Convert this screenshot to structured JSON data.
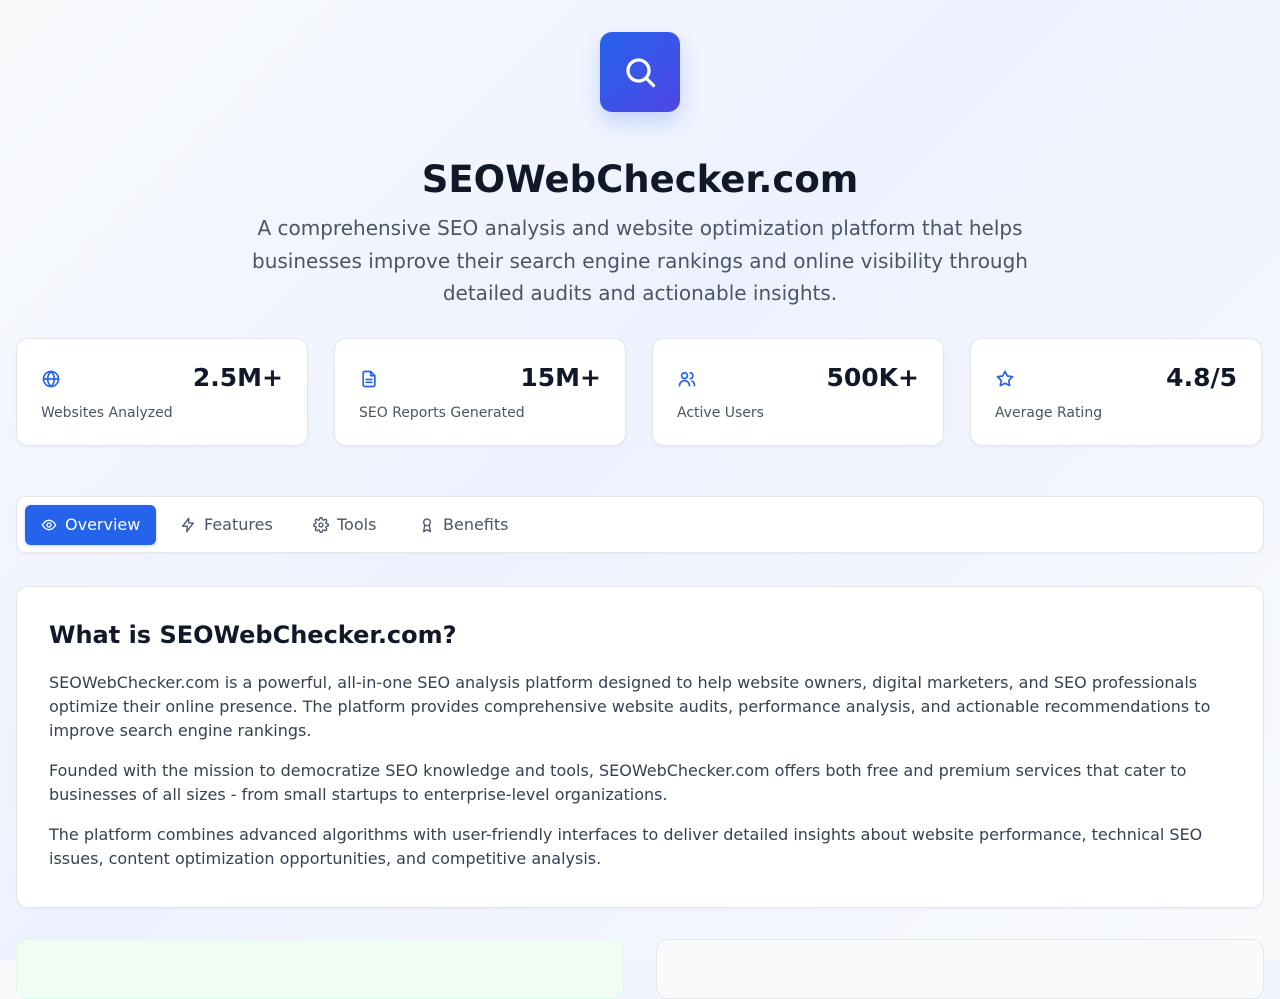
{
  "hero": {
    "title": "SEOWebChecker.com",
    "description": "A comprehensive SEO analysis and website optimization platform that helps businesses improve their search engine rankings and online visibility through detailed audits and actionable insights.",
    "logo_icon": "search-icon"
  },
  "stats": [
    {
      "value": "2.5M+",
      "label": "Websites Analyzed",
      "icon": "globe-icon"
    },
    {
      "value": "15M+",
      "label": "SEO Reports Generated",
      "icon": "document-icon"
    },
    {
      "value": "500K+",
      "label": "Active Users",
      "icon": "users-icon"
    },
    {
      "value": "4.8/5",
      "label": "Average Rating",
      "icon": "star-icon"
    }
  ],
  "tabs": [
    {
      "label": "Overview",
      "icon": "eye-icon",
      "selected": true
    },
    {
      "label": "Features",
      "icon": "zap-icon",
      "selected": false
    },
    {
      "label": "Tools",
      "icon": "gear-icon",
      "selected": false
    },
    {
      "label": "Benefits",
      "icon": "award-icon",
      "selected": false
    }
  ],
  "overview": {
    "title": "What is SEOWebChecker.com?",
    "paragraphs": [
      "SEOWebChecker.com is a powerful, all-in-one SEO analysis platform designed to help website owners, digital marketers, and SEO professionals optimize their online presence. The platform provides comprehensive website audits, performance analysis, and actionable recommendations to improve search engine rankings.",
      "Founded with the mission to democratize SEO knowledge and tools, SEOWebChecker.com offers both free and premium services that cater to businesses of all sizes - from small startups to enterprise-level organizations.",
      "The platform combines advanced algorithms with user-friendly interfaces to deliver detailed insights about website performance, technical SEO issues, content optimization opportunities, and competitive analysis."
    ]
  },
  "colors": {
    "primary": "#2563eb",
    "accent_indigo": "#4f46e5",
    "heading": "#111827",
    "body_text": "#374151",
    "muted_text": "#4b5563",
    "border": "#e5e7eb",
    "success_tint": "#f0fdf4"
  }
}
